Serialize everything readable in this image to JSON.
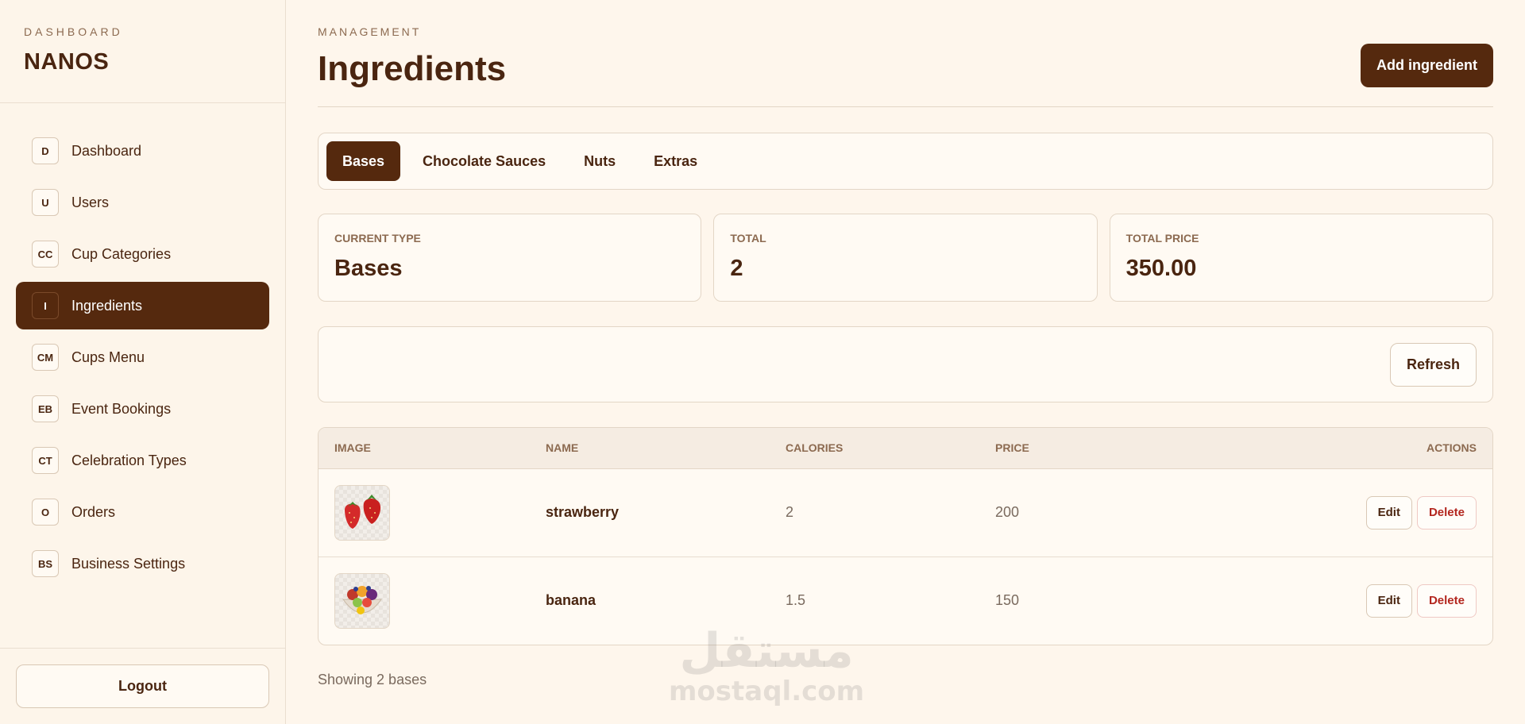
{
  "sidebar": {
    "eyebrow": "DASHBOARD",
    "brand": "NANOS",
    "items": [
      {
        "badge": "D",
        "label": "Dashboard"
      },
      {
        "badge": "U",
        "label": "Users"
      },
      {
        "badge": "CC",
        "label": "Cup Categories"
      },
      {
        "badge": "I",
        "label": "Ingredients",
        "active": true
      },
      {
        "badge": "CM",
        "label": "Cups Menu"
      },
      {
        "badge": "EB",
        "label": "Event Bookings"
      },
      {
        "badge": "CT",
        "label": "Celebration Types"
      },
      {
        "badge": "O",
        "label": "Orders"
      },
      {
        "badge": "BS",
        "label": "Business Settings"
      }
    ],
    "logout_label": "Logout"
  },
  "header": {
    "eyebrow": "MANAGEMENT",
    "title": "Ingredients",
    "add_label": "Add ingredient"
  },
  "tabs": [
    {
      "label": "Bases",
      "active": true
    },
    {
      "label": "Chocolate Sauces"
    },
    {
      "label": "Nuts"
    },
    {
      "label": "Extras"
    }
  ],
  "stats": [
    {
      "label": "CURRENT TYPE",
      "value": "Bases"
    },
    {
      "label": "TOTAL",
      "value": "2"
    },
    {
      "label": "TOTAL PRICE",
      "value": "350.00"
    }
  ],
  "toolbar": {
    "refresh_label": "Refresh"
  },
  "table": {
    "columns": [
      "IMAGE",
      "NAME",
      "CALORIES",
      "PRICE",
      "ACTIONS"
    ],
    "rows": [
      {
        "image": "strawberry-image",
        "name": "strawberry",
        "calories": "2",
        "price": "200",
        "edit": "Edit",
        "delete": "Delete"
      },
      {
        "image": "fruit-bowl-image",
        "name": "banana",
        "calories": "1.5",
        "price": "150",
        "edit": "Edit",
        "delete": "Delete"
      }
    ]
  },
  "footer_note": "Showing 2 bases",
  "watermark": {
    "arabic": "مستقل",
    "latin": "mostaql.com"
  },
  "colors": {
    "accent": "#55290e",
    "background": "#fef6ec",
    "text": "#4a2510",
    "muted": "#8c6a50",
    "danger": "#b3261e"
  }
}
